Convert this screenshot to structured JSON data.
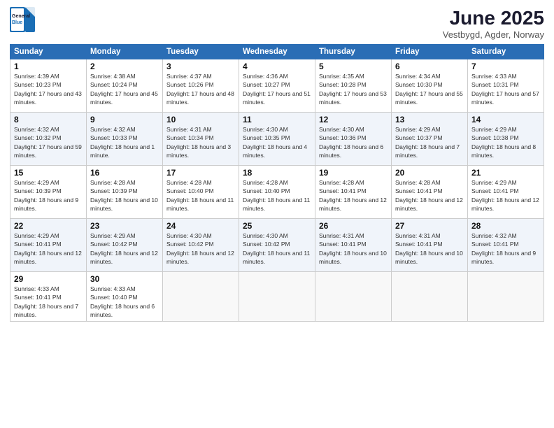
{
  "logo": {
    "general": "General",
    "blue": "Blue"
  },
  "title": "June 2025",
  "location": "Vestbygd, Agder, Norway",
  "headers": [
    "Sunday",
    "Monday",
    "Tuesday",
    "Wednesday",
    "Thursday",
    "Friday",
    "Saturday"
  ],
  "weeks": [
    [
      {
        "day": "1",
        "rise": "4:39 AM",
        "set": "10:23 PM",
        "daylight": "17 hours and 43 minutes."
      },
      {
        "day": "2",
        "rise": "4:38 AM",
        "set": "10:24 PM",
        "daylight": "17 hours and 45 minutes."
      },
      {
        "day": "3",
        "rise": "4:37 AM",
        "set": "10:26 PM",
        "daylight": "17 hours and 48 minutes."
      },
      {
        "day": "4",
        "rise": "4:36 AM",
        "set": "10:27 PM",
        "daylight": "17 hours and 51 minutes."
      },
      {
        "day": "5",
        "rise": "4:35 AM",
        "set": "10:28 PM",
        "daylight": "17 hours and 53 minutes."
      },
      {
        "day": "6",
        "rise": "4:34 AM",
        "set": "10:30 PM",
        "daylight": "17 hours and 55 minutes."
      },
      {
        "day": "7",
        "rise": "4:33 AM",
        "set": "10:31 PM",
        "daylight": "17 hours and 57 minutes."
      }
    ],
    [
      {
        "day": "8",
        "rise": "4:32 AM",
        "set": "10:32 PM",
        "daylight": "17 hours and 59 minutes."
      },
      {
        "day": "9",
        "rise": "4:32 AM",
        "set": "10:33 PM",
        "daylight": "18 hours and 1 minute."
      },
      {
        "day": "10",
        "rise": "4:31 AM",
        "set": "10:34 PM",
        "daylight": "18 hours and 3 minutes."
      },
      {
        "day": "11",
        "rise": "4:30 AM",
        "set": "10:35 PM",
        "daylight": "18 hours and 4 minutes."
      },
      {
        "day": "12",
        "rise": "4:30 AM",
        "set": "10:36 PM",
        "daylight": "18 hours and 6 minutes."
      },
      {
        "day": "13",
        "rise": "4:29 AM",
        "set": "10:37 PM",
        "daylight": "18 hours and 7 minutes."
      },
      {
        "day": "14",
        "rise": "4:29 AM",
        "set": "10:38 PM",
        "daylight": "18 hours and 8 minutes."
      }
    ],
    [
      {
        "day": "15",
        "rise": "4:29 AM",
        "set": "10:39 PM",
        "daylight": "18 hours and 9 minutes."
      },
      {
        "day": "16",
        "rise": "4:28 AM",
        "set": "10:39 PM",
        "daylight": "18 hours and 10 minutes."
      },
      {
        "day": "17",
        "rise": "4:28 AM",
        "set": "10:40 PM",
        "daylight": "18 hours and 11 minutes."
      },
      {
        "day": "18",
        "rise": "4:28 AM",
        "set": "10:40 PM",
        "daylight": "18 hours and 11 minutes."
      },
      {
        "day": "19",
        "rise": "4:28 AM",
        "set": "10:41 PM",
        "daylight": "18 hours and 12 minutes."
      },
      {
        "day": "20",
        "rise": "4:28 AM",
        "set": "10:41 PM",
        "daylight": "18 hours and 12 minutes."
      },
      {
        "day": "21",
        "rise": "4:29 AM",
        "set": "10:41 PM",
        "daylight": "18 hours and 12 minutes."
      }
    ],
    [
      {
        "day": "22",
        "rise": "4:29 AM",
        "set": "10:41 PM",
        "daylight": "18 hours and 12 minutes."
      },
      {
        "day": "23",
        "rise": "4:29 AM",
        "set": "10:42 PM",
        "daylight": "18 hours and 12 minutes."
      },
      {
        "day": "24",
        "rise": "4:30 AM",
        "set": "10:42 PM",
        "daylight": "18 hours and 12 minutes."
      },
      {
        "day": "25",
        "rise": "4:30 AM",
        "set": "10:42 PM",
        "daylight": "18 hours and 11 minutes."
      },
      {
        "day": "26",
        "rise": "4:31 AM",
        "set": "10:41 PM",
        "daylight": "18 hours and 10 minutes."
      },
      {
        "day": "27",
        "rise": "4:31 AM",
        "set": "10:41 PM",
        "daylight": "18 hours and 10 minutes."
      },
      {
        "day": "28",
        "rise": "4:32 AM",
        "set": "10:41 PM",
        "daylight": "18 hours and 9 minutes."
      }
    ],
    [
      {
        "day": "29",
        "rise": "4:33 AM",
        "set": "10:41 PM",
        "daylight": "18 hours and 7 minutes."
      },
      {
        "day": "30",
        "rise": "4:33 AM",
        "set": "10:40 PM",
        "daylight": "18 hours and 6 minutes."
      },
      null,
      null,
      null,
      null,
      null
    ]
  ]
}
